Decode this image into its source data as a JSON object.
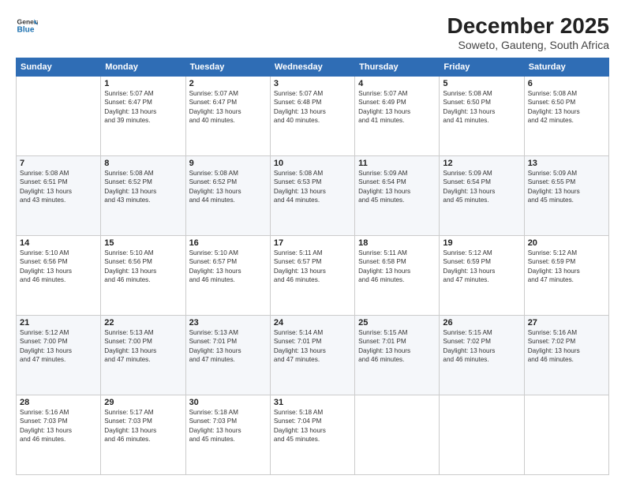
{
  "logo": {
    "line1": "General",
    "line2": "Blue"
  },
  "title": "December 2025",
  "subtitle": "Soweto, Gauteng, South Africa",
  "weekdays": [
    "Sunday",
    "Monday",
    "Tuesday",
    "Wednesday",
    "Thursday",
    "Friday",
    "Saturday"
  ],
  "weeks": [
    [
      {
        "day": "",
        "info": ""
      },
      {
        "day": "1",
        "info": "Sunrise: 5:07 AM\nSunset: 6:47 PM\nDaylight: 13 hours\nand 39 minutes."
      },
      {
        "day": "2",
        "info": "Sunrise: 5:07 AM\nSunset: 6:47 PM\nDaylight: 13 hours\nand 40 minutes."
      },
      {
        "day": "3",
        "info": "Sunrise: 5:07 AM\nSunset: 6:48 PM\nDaylight: 13 hours\nand 40 minutes."
      },
      {
        "day": "4",
        "info": "Sunrise: 5:07 AM\nSunset: 6:49 PM\nDaylight: 13 hours\nand 41 minutes."
      },
      {
        "day": "5",
        "info": "Sunrise: 5:08 AM\nSunset: 6:50 PM\nDaylight: 13 hours\nand 41 minutes."
      },
      {
        "day": "6",
        "info": "Sunrise: 5:08 AM\nSunset: 6:50 PM\nDaylight: 13 hours\nand 42 minutes."
      }
    ],
    [
      {
        "day": "7",
        "info": "Sunrise: 5:08 AM\nSunset: 6:51 PM\nDaylight: 13 hours\nand 43 minutes."
      },
      {
        "day": "8",
        "info": "Sunrise: 5:08 AM\nSunset: 6:52 PM\nDaylight: 13 hours\nand 43 minutes."
      },
      {
        "day": "9",
        "info": "Sunrise: 5:08 AM\nSunset: 6:52 PM\nDaylight: 13 hours\nand 44 minutes."
      },
      {
        "day": "10",
        "info": "Sunrise: 5:08 AM\nSunset: 6:53 PM\nDaylight: 13 hours\nand 44 minutes."
      },
      {
        "day": "11",
        "info": "Sunrise: 5:09 AM\nSunset: 6:54 PM\nDaylight: 13 hours\nand 45 minutes."
      },
      {
        "day": "12",
        "info": "Sunrise: 5:09 AM\nSunset: 6:54 PM\nDaylight: 13 hours\nand 45 minutes."
      },
      {
        "day": "13",
        "info": "Sunrise: 5:09 AM\nSunset: 6:55 PM\nDaylight: 13 hours\nand 45 minutes."
      }
    ],
    [
      {
        "day": "14",
        "info": "Sunrise: 5:10 AM\nSunset: 6:56 PM\nDaylight: 13 hours\nand 46 minutes."
      },
      {
        "day": "15",
        "info": "Sunrise: 5:10 AM\nSunset: 6:56 PM\nDaylight: 13 hours\nand 46 minutes."
      },
      {
        "day": "16",
        "info": "Sunrise: 5:10 AM\nSunset: 6:57 PM\nDaylight: 13 hours\nand 46 minutes."
      },
      {
        "day": "17",
        "info": "Sunrise: 5:11 AM\nSunset: 6:57 PM\nDaylight: 13 hours\nand 46 minutes."
      },
      {
        "day": "18",
        "info": "Sunrise: 5:11 AM\nSunset: 6:58 PM\nDaylight: 13 hours\nand 46 minutes."
      },
      {
        "day": "19",
        "info": "Sunrise: 5:12 AM\nSunset: 6:59 PM\nDaylight: 13 hours\nand 47 minutes."
      },
      {
        "day": "20",
        "info": "Sunrise: 5:12 AM\nSunset: 6:59 PM\nDaylight: 13 hours\nand 47 minutes."
      }
    ],
    [
      {
        "day": "21",
        "info": "Sunrise: 5:12 AM\nSunset: 7:00 PM\nDaylight: 13 hours\nand 47 minutes."
      },
      {
        "day": "22",
        "info": "Sunrise: 5:13 AM\nSunset: 7:00 PM\nDaylight: 13 hours\nand 47 minutes."
      },
      {
        "day": "23",
        "info": "Sunrise: 5:13 AM\nSunset: 7:01 PM\nDaylight: 13 hours\nand 47 minutes."
      },
      {
        "day": "24",
        "info": "Sunrise: 5:14 AM\nSunset: 7:01 PM\nDaylight: 13 hours\nand 47 minutes."
      },
      {
        "day": "25",
        "info": "Sunrise: 5:15 AM\nSunset: 7:01 PM\nDaylight: 13 hours\nand 46 minutes."
      },
      {
        "day": "26",
        "info": "Sunrise: 5:15 AM\nSunset: 7:02 PM\nDaylight: 13 hours\nand 46 minutes."
      },
      {
        "day": "27",
        "info": "Sunrise: 5:16 AM\nSunset: 7:02 PM\nDaylight: 13 hours\nand 46 minutes."
      }
    ],
    [
      {
        "day": "28",
        "info": "Sunrise: 5:16 AM\nSunset: 7:03 PM\nDaylight: 13 hours\nand 46 minutes."
      },
      {
        "day": "29",
        "info": "Sunrise: 5:17 AM\nSunset: 7:03 PM\nDaylight: 13 hours\nand 46 minutes."
      },
      {
        "day": "30",
        "info": "Sunrise: 5:18 AM\nSunset: 7:03 PM\nDaylight: 13 hours\nand 45 minutes."
      },
      {
        "day": "31",
        "info": "Sunrise: 5:18 AM\nSunset: 7:04 PM\nDaylight: 13 hours\nand 45 minutes."
      },
      {
        "day": "",
        "info": ""
      },
      {
        "day": "",
        "info": ""
      },
      {
        "day": "",
        "info": ""
      }
    ]
  ]
}
